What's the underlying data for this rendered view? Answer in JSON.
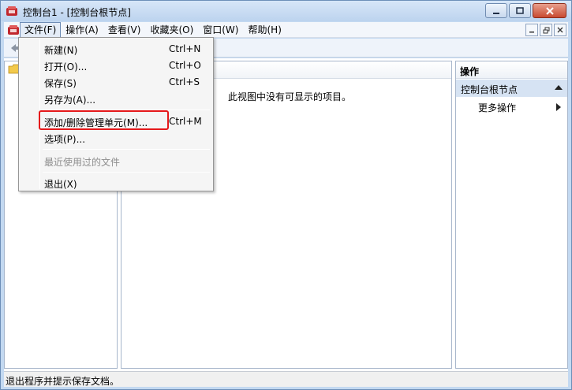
{
  "window": {
    "title": "控制台1 - [控制台根节点]"
  },
  "menubar": {
    "items": [
      {
        "label": "文件(F)",
        "active": true
      },
      {
        "label": "操作(A)"
      },
      {
        "label": "查看(V)"
      },
      {
        "label": "收藏夹(O)"
      },
      {
        "label": "窗口(W)"
      },
      {
        "label": "帮助(H)"
      }
    ]
  },
  "file_menu": {
    "items": [
      {
        "label": "新建(N)",
        "shortcut": "Ctrl+N"
      },
      {
        "label": "打开(O)...",
        "shortcut": "Ctrl+O"
      },
      {
        "label": "保存(S)",
        "shortcut": "Ctrl+S"
      },
      {
        "label": "另存为(A)..."
      },
      {
        "label": "添加/删除管理单元(M)...",
        "shortcut": "Ctrl+M",
        "highlighted": true
      },
      {
        "label": "选项(P)..."
      },
      {
        "label": "最近使用过的文件",
        "disabled": true
      },
      {
        "label": "退出(X)"
      }
    ]
  },
  "center": {
    "empty_message": "此视图中没有可显示的项目。"
  },
  "actions": {
    "title": "操作",
    "section": "控制台根节点",
    "more": "更多操作"
  },
  "statusbar": {
    "text": "退出程序并提示保存文档。"
  },
  "colors": {
    "highlight_border": "#e5191b",
    "section_bg": "#d6e3f3"
  }
}
